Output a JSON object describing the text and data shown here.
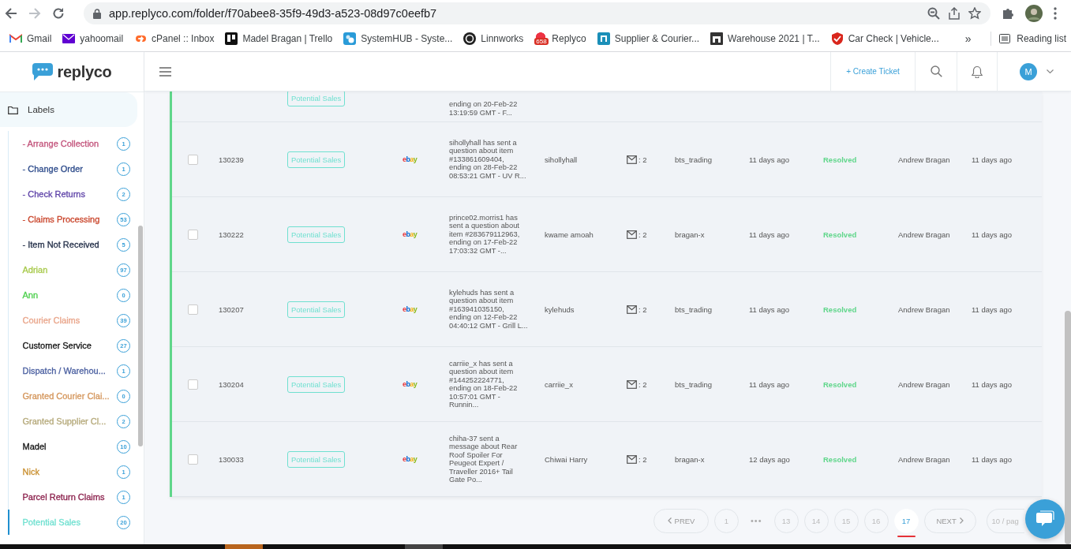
{
  "browser": {
    "url": "app.replyco.com/folder/f70abee8-35f9-49d3-a523-08d97c0eefb7",
    "bookmarks": [
      {
        "label": "Gmail"
      },
      {
        "label": "yahoomail"
      },
      {
        "label": "cPanel :: Inbox"
      },
      {
        "label": "Madel Bragan | Trello"
      },
      {
        "label": "SystemHUB - Syste..."
      },
      {
        "label": "Linnworks"
      },
      {
        "label": "Replyco",
        "badge": "658"
      },
      {
        "label": "Supplier & Courier..."
      },
      {
        "label": "Warehouse 2021 | T..."
      },
      {
        "label": "Car Check | Vehicle..."
      }
    ],
    "more": "»",
    "reading_list": "Reading list"
  },
  "app": {
    "logo": "replyco",
    "create_ticket": "+ Create Ticket",
    "avatar": "M"
  },
  "sidebar": {
    "section": "Labels",
    "labels": [
      {
        "name": "- Arrange Collection",
        "count": "1",
        "color": "#c2527a",
        "selected": false
      },
      {
        "name": "- Change Order",
        "count": "1",
        "color": "#2c4a8a",
        "selected": false
      },
      {
        "name": "- Check Returns",
        "count": "2",
        "color": "#5b3fa6",
        "selected": false
      },
      {
        "name": "- Claims Processing",
        "count": "53",
        "color": "#c9442a",
        "selected": false
      },
      {
        "name": "- Item Not Received",
        "count": "5",
        "color": "#1e2a44",
        "selected": false
      },
      {
        "name": "Adrian",
        "count": "97",
        "color": "#a7c94a",
        "selected": false
      },
      {
        "name": "Ann",
        "count": "0",
        "color": "#4ccf4c",
        "selected": false
      },
      {
        "name": "Courier Claims",
        "count": "39",
        "color": "#e9a58a",
        "selected": false
      },
      {
        "name": "Customer Service",
        "count": "27",
        "color": "#111111",
        "selected": false
      },
      {
        "name": "Dispatch / Warehou...",
        "count": "1",
        "color": "#4a5fa0",
        "selected": false
      },
      {
        "name": "Granted Courier Clai...",
        "count": "0",
        "color": "#d4955a",
        "selected": false
      },
      {
        "name": "Granted Supplier Cl...",
        "count": "2",
        "color": "#b5a97a",
        "selected": false
      },
      {
        "name": "Madel",
        "count": "10",
        "color": "#111111",
        "selected": false
      },
      {
        "name": "Nick",
        "count": "1",
        "color": "#c98f2e",
        "selected": false
      },
      {
        "name": "Parcel Return Claims",
        "count": "1",
        "color": "#8a1e4a",
        "selected": false
      },
      {
        "name": "Potential Sales",
        "count": "20",
        "color": "#6fe0d0",
        "selected": true
      }
    ]
  },
  "tickets": {
    "partial_row": {
      "tag": "Potential Sales",
      "message": "ending on 20-Feb-22 13:19:59 GMT - F..."
    },
    "rows": [
      {
        "checked": false,
        "id": "130239",
        "tag": "Potential Sales",
        "channel": "ebay",
        "message": "sihollyhall has sent a question about item #133861609404, ending on 28-Feb-22 08:53:21 GMT - UV R...",
        "customer": "sihollyhall",
        "messages": ": 2",
        "account": "bts_trading",
        "created": "11 days ago",
        "status": "Resolved",
        "assignee": "Andrew Bragan",
        "updated": "11 days ago"
      },
      {
        "checked": false,
        "id": "130222",
        "tag": "Potential Sales",
        "channel": "ebay",
        "message": "prince02.morris1 has sent a question about item #283679112963, ending on 17-Feb-22 17:03:32 GMT -...",
        "customer": "kwame amoah",
        "messages": ": 2",
        "account": "bragan-x",
        "created": "11 days ago",
        "status": "Resolved",
        "assignee": "Andrew Bragan",
        "updated": "11 days ago"
      },
      {
        "checked": false,
        "id": "130207",
        "tag": "Potential Sales",
        "channel": "ebay",
        "message": "kylehuds has sent a question about item #163941035150, ending on 12-Feb-22 04:40:12 GMT - Grill L...",
        "customer": "kylehuds",
        "messages": ": 2",
        "account": "bts_trading",
        "created": "11 days ago",
        "status": "Resolved",
        "assignee": "Andrew Bragan",
        "updated": "11 days ago"
      },
      {
        "checked": false,
        "id": "130204",
        "tag": "Potential Sales",
        "channel": "ebay",
        "message": "carriie_x has sent a question about item #144252224771, ending on 18-Feb-22 10:57:01 GMT - Runnin...",
        "customer": "carriie_x",
        "messages": ": 2",
        "account": "bts_trading",
        "created": "11 days ago",
        "status": "Resolved",
        "assignee": "Andrew Bragan",
        "updated": "11 days ago"
      },
      {
        "checked": false,
        "id": "130033",
        "tag": "Potential Sales",
        "channel": "ebay",
        "message": "chiha-37 sent a message about Rear Roof Spoiler For Peugeot Expert / Traveller 2016+ Tail Gate Po...",
        "customer": "Chiwai Harry",
        "messages": ": 2",
        "account": "bragan-x",
        "created": "12 days ago",
        "status": "Resolved",
        "assignee": "Andrew Bragan",
        "updated": "11 days ago"
      }
    ]
  },
  "pagination": {
    "prev": {
      "label": "PREV",
      "disabled": true
    },
    "items": [
      {
        "kind": "page",
        "label": "1",
        "selected": false
      },
      {
        "kind": "ellipsis",
        "label": "•••",
        "selected": false
      },
      {
        "kind": "page",
        "label": "13",
        "selected": false
      },
      {
        "kind": "page",
        "label": "14",
        "selected": false
      },
      {
        "kind": "page",
        "label": "15",
        "selected": false
      },
      {
        "kind": "page",
        "label": "16",
        "selected": false
      },
      {
        "kind": "page",
        "label": "17",
        "selected": true
      }
    ],
    "next": {
      "label": "NEXT",
      "disabled": true
    },
    "page_size": "10 / pag"
  }
}
